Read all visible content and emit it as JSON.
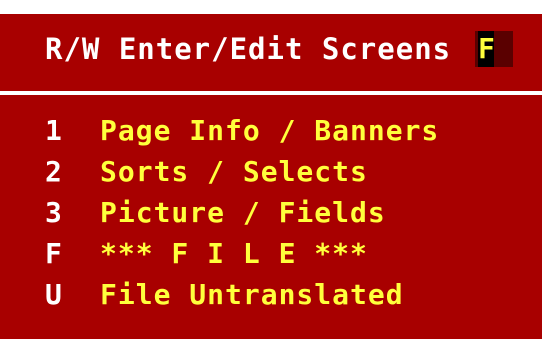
{
  "screen": {
    "title": "R/W Enter/Edit Screens",
    "input_value": "F"
  },
  "menu": {
    "items": [
      {
        "key": "1",
        "label": "Page Info / Banners"
      },
      {
        "key": "2",
        "label": "Sorts / Selects"
      },
      {
        "key": "3",
        "label": "Picture / Fields"
      },
      {
        "key": "F",
        "label": "*** F I L E ***"
      },
      {
        "key": "U",
        "label": "File Untranslated"
      }
    ]
  },
  "colors": {
    "background": "#a80000",
    "title_text": "#ffffff",
    "item_text": "#ffff3c",
    "divider": "#ffffff"
  }
}
